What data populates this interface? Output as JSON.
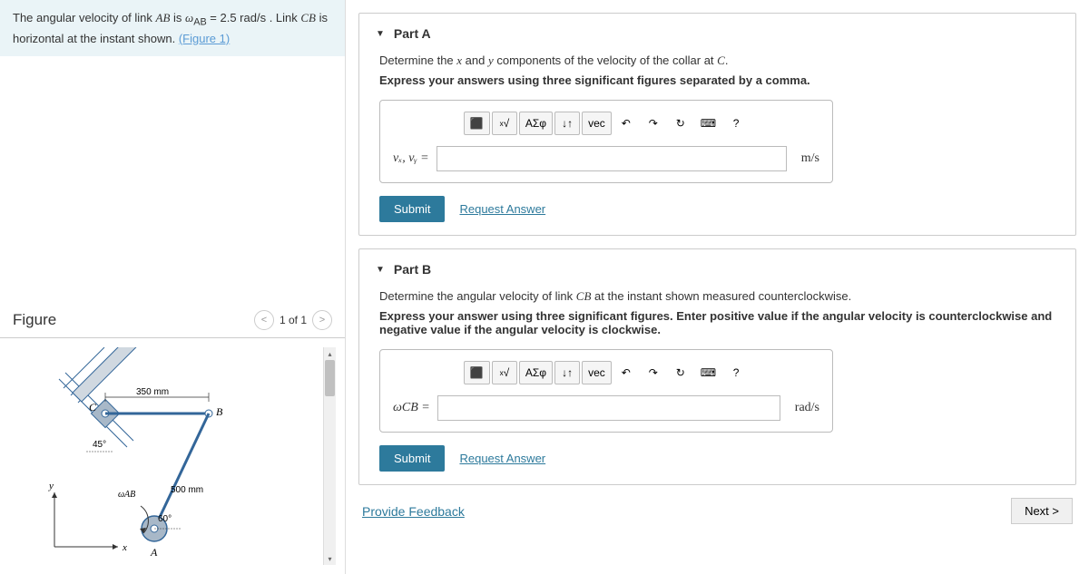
{
  "problem": {
    "text_1": "The angular velocity of link ",
    "link1": "AB",
    "text_2": " is ",
    "omega": "ω",
    "sub": "AB",
    "text_3": " = 2.5  rad/s . Link ",
    "link2": "CB",
    "text_4": " is horizontal at the instant shown. ",
    "figure_link": "(Figure 1)"
  },
  "figure": {
    "title": "Figure",
    "nav_label": "1 of 1",
    "dim_cb": "350 mm",
    "dim_ab": "500 mm",
    "angle_c": "45°",
    "angle_a": "60°",
    "omega_label": "ωAB",
    "pt_a": "A",
    "pt_b": "B",
    "pt_c": "C",
    "axis_x": "x",
    "axis_y": "y"
  },
  "partA": {
    "title": "Part A",
    "prompt_1": "Determine the ",
    "var_x": "x",
    "prompt_2": " and ",
    "var_y": "y",
    "prompt_3": " components of the velocity of the collar at ",
    "var_c": "C",
    "prompt_4": ".",
    "instruction": "Express your answers using three significant figures separated by a comma.",
    "input_label": "vₓ, vᵧ =",
    "unit": "m/s",
    "submit": "Submit",
    "request": "Request Answer"
  },
  "partB": {
    "title": "Part B",
    "prompt": "Determine the angular velocity of link ",
    "var_cb": "CB",
    "prompt_2": " at the instant shown measured counterclockwise.",
    "instruction": "Express your answer using three significant figures. Enter positive value if the angular velocity is counterclockwise and negative value if the angular velocity is clockwise.",
    "input_label": "ωCB =",
    "unit": "rad/s",
    "submit": "Submit",
    "request": "Request Answer"
  },
  "toolbar": {
    "templates": "⬛",
    "sqrt": "√",
    "greek": "ΑΣφ",
    "updown": "↓↑",
    "vec": "vec",
    "undo": "↶",
    "redo": "↷",
    "reset": "↻",
    "keyboard": "⌨",
    "help": "?"
  },
  "footer": {
    "feedback": "Provide Feedback",
    "next": "Next >"
  }
}
